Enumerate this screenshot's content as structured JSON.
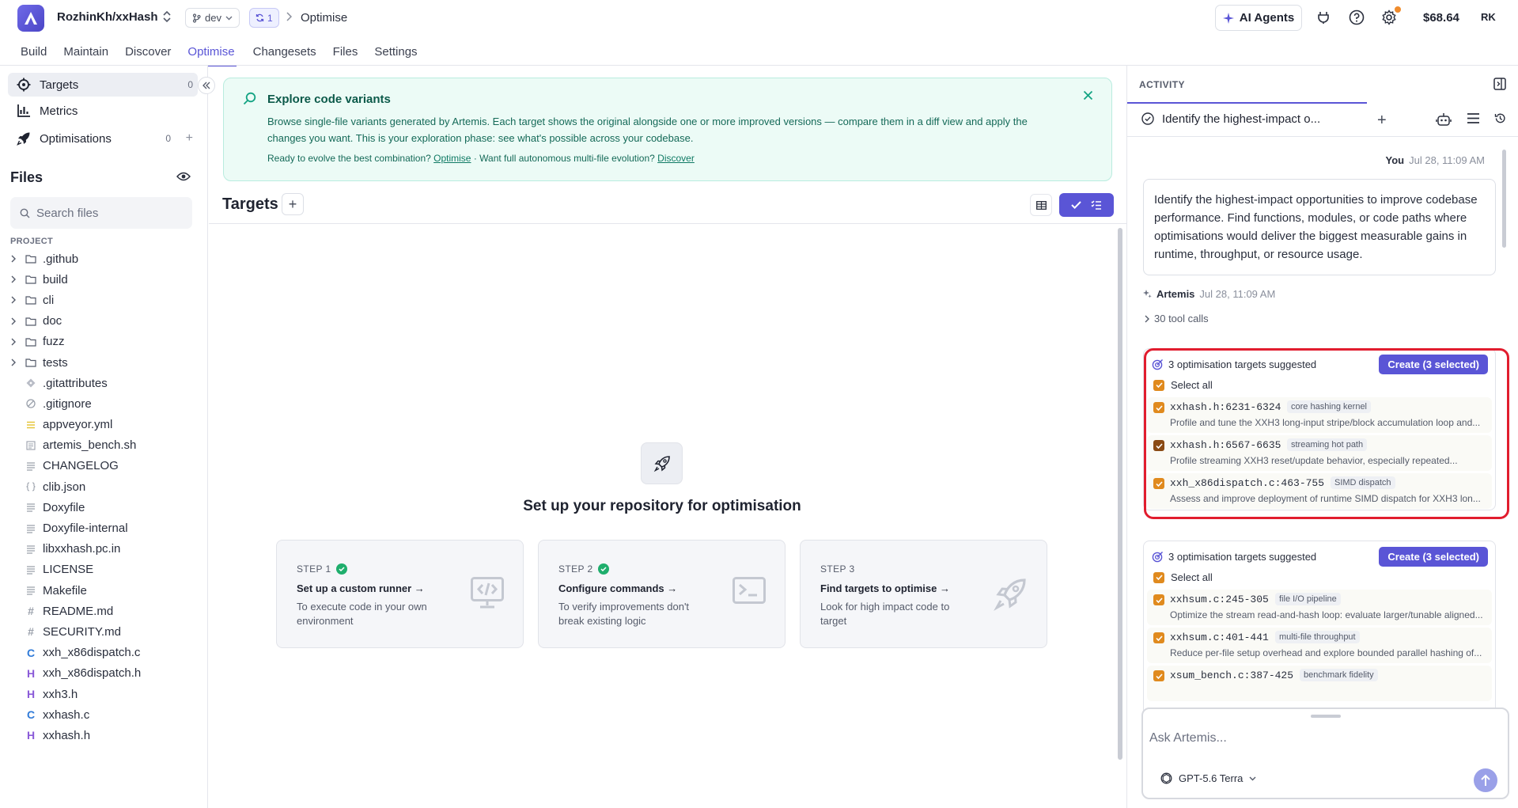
{
  "topbar": {
    "repo": "RozhinKh/xxHash",
    "branch": "dev",
    "sync_count": "1",
    "breadcrumb_current": "Optimise",
    "ai_agents_label": "AI Agents",
    "balance": "$68.64",
    "avatar_initials": "RK"
  },
  "nav": {
    "tabs": [
      {
        "label": "Build"
      },
      {
        "label": "Maintain"
      },
      {
        "label": "Discover"
      },
      {
        "label": "Optimise",
        "active": true
      },
      {
        "label": "Changesets"
      },
      {
        "label": "Files"
      },
      {
        "label": "Settings"
      }
    ]
  },
  "sidebar": {
    "items": [
      {
        "label": "Targets",
        "count": "0",
        "icon": "target-icon",
        "active": true
      },
      {
        "label": "Metrics",
        "icon": "bar-chart-icon"
      },
      {
        "label": "Optimisations",
        "count": "0",
        "icon": "rocket-icon"
      }
    ],
    "files_title": "Files",
    "search_placeholder": "Search files",
    "project_label": "PROJECT",
    "tree": [
      {
        "name": ".github",
        "type": "folder"
      },
      {
        "name": "build",
        "type": "folder"
      },
      {
        "name": "cli",
        "type": "folder"
      },
      {
        "name": "doc",
        "type": "folder"
      },
      {
        "name": "fuzz",
        "type": "folder"
      },
      {
        "name": "tests",
        "type": "folder"
      },
      {
        "name": ".gitattributes",
        "type": "git"
      },
      {
        "name": ".gitignore",
        "type": "ignore"
      },
      {
        "name": "appveyor.yml",
        "type": "yaml"
      },
      {
        "name": "artemis_bench.sh",
        "type": "shell"
      },
      {
        "name": "CHANGELOG",
        "type": "text"
      },
      {
        "name": "clib.json",
        "type": "json"
      },
      {
        "name": "Doxyfile",
        "type": "text"
      },
      {
        "name": "Doxyfile-internal",
        "type": "text"
      },
      {
        "name": "libxxhash.pc.in",
        "type": "text"
      },
      {
        "name": "LICENSE",
        "type": "text"
      },
      {
        "name": "Makefile",
        "type": "text"
      },
      {
        "name": "README.md",
        "type": "markdown"
      },
      {
        "name": "SECURITY.md",
        "type": "markdown"
      },
      {
        "name": "xxh_x86dispatch.c",
        "type": "c"
      },
      {
        "name": "xxh_x86dispatch.h",
        "type": "h"
      },
      {
        "name": "xxh3.h",
        "type": "h"
      },
      {
        "name": "xxhash.c",
        "type": "c"
      },
      {
        "name": "xxhash.h",
        "type": "h"
      }
    ]
  },
  "banner": {
    "title": "Explore code variants",
    "body": "Browse single-file variants generated by Artemis. Each target shows the original alongside one or more improved versions — compare them in a diff view and apply the changes you want. This is your exploration phase: see what's possible across your codebase.",
    "foot_prefix": "Ready to evolve the best combination? ",
    "foot_link1": "Optimise",
    "foot_mid": " · Want full autonomous multi-file evolution? ",
    "foot_link2": "Discover"
  },
  "main": {
    "title": "Targets",
    "setup_title": "Set up your repository for optimisation",
    "steps": [
      {
        "num": "STEP 1",
        "done": true,
        "title": "Set up a custom runner →",
        "desc": "To execute code in your own environment",
        "icon": "code-window-icon"
      },
      {
        "num": "STEP 2",
        "done": true,
        "title": "Configure commands →",
        "desc": "To verify improvements don't break existing logic",
        "icon": "terminal-icon"
      },
      {
        "num": "STEP 3",
        "done": false,
        "title": "Find targets to optimise →",
        "desc": "Look for high impact code to target",
        "icon": "rocket-icon"
      }
    ]
  },
  "activity": {
    "title": "ACTIVITY",
    "tab_title": "Identify the highest-impact o...",
    "user_name": "You",
    "user_time": "Jul 28, 11:09 AM",
    "user_message": "Identify the highest-impact opportunities to improve codebase performance. Find functions, modules, or code paths where optimisations would deliver the biggest measurable gains in runtime, throughput, or resource usage.",
    "agent_name": "Artemis",
    "agent_time": "Jul 28, 11:09 AM",
    "tool_calls": "30 tool calls",
    "suggestions": [
      {
        "heading": "3 optimisation targets suggested",
        "create_label": "Create (3 selected)",
        "select_all": "Select all",
        "targets": [
          {
            "loc": "xxhash.h:6231-6324",
            "tag": "core hashing kernel",
            "desc": "Profile and tune the XXH3 long-input stripe/block accumulation loop and..."
          },
          {
            "loc": "xxhash.h:6567-6635",
            "tag": "streaming hot path",
            "desc": "Profile streaming XXH3 reset/update behavior, especially repeated..."
          },
          {
            "loc": "xxh_x86dispatch.c:463-755",
            "tag": "SIMD dispatch",
            "desc": "Assess and improve deployment of runtime SIMD dispatch for XXH3 lon..."
          }
        ]
      },
      {
        "heading": "3 optimisation targets suggested",
        "create_label": "Create (3 selected)",
        "select_all": "Select all",
        "targets": [
          {
            "loc": "xxhsum.c:245-305",
            "tag": "file I/O pipeline",
            "desc": "Optimize the stream read-and-hash loop: evaluate larger/tunable aligned..."
          },
          {
            "loc": "xxhsum.c:401-441",
            "tag": "multi-file throughput",
            "desc": "Reduce per-file setup overhead and explore bounded parallel hashing of..."
          },
          {
            "loc": "xsum_bench.c:387-425",
            "tag": "benchmark fidelity",
            "desc": ""
          }
        ]
      }
    ],
    "composer_placeholder": "Ask Artemis...",
    "model": "GPT-5.6 Terra"
  },
  "colors": {
    "accent": "#5a55d6",
    "banner_bg": "#ecfbf6",
    "checkbox": "#e08a1e",
    "highlight": "#e11d2e",
    "success": "#1fae6d"
  }
}
